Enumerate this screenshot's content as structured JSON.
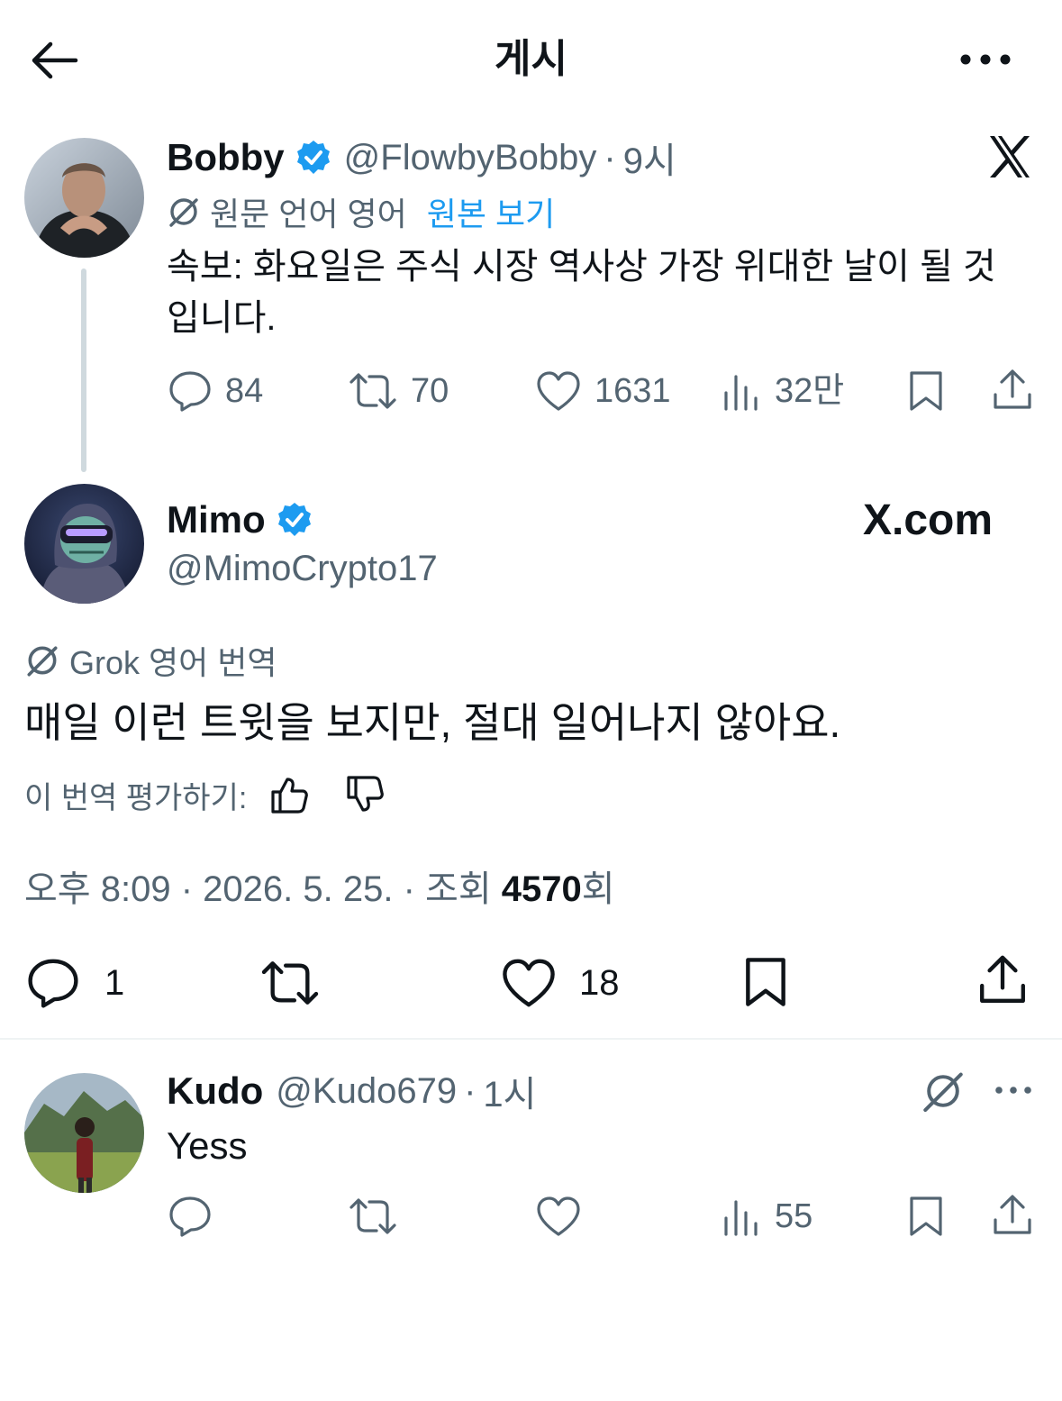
{
  "header": {
    "title": "게시"
  },
  "original": {
    "name": "Bobby",
    "handle": "@FlowbyBobby",
    "time": "9시",
    "translate_note": "원문 언어 영어",
    "view_original": "원본 보기",
    "text_line1": "속보: 화요일은 주식 시장 역사상 가장 위대한 날이 될 것",
    "text_line2": "입니다.",
    "stats": {
      "replies": "84",
      "reposts": "70",
      "likes": "1631",
      "views": "32만"
    }
  },
  "main": {
    "name": "Mimo",
    "handle": "@MimoCrypto17",
    "watermark": "X.com",
    "translate_note": "Grok 영어 번역",
    "text": "매일 이런 트윗을 보지만, 절대 일어나지 않아요.",
    "rate_label": "이 번역 평가하기:",
    "meta_time": "오후 8:09",
    "meta_date": "2026. 5. 25.",
    "meta_views_label": "조회",
    "meta_views_count": "4570",
    "meta_views_suffix": "회",
    "stats": {
      "replies": "1",
      "likes": "18"
    }
  },
  "reply": {
    "name": "Kudo",
    "handle": "@Kudo679",
    "time": "1시",
    "text": "Yess",
    "stats": {
      "views": "55"
    }
  },
  "colors": {
    "accent": "#1d9bf0",
    "text": "#0f1419",
    "muted": "#536471",
    "divider": "#eff3f4"
  }
}
